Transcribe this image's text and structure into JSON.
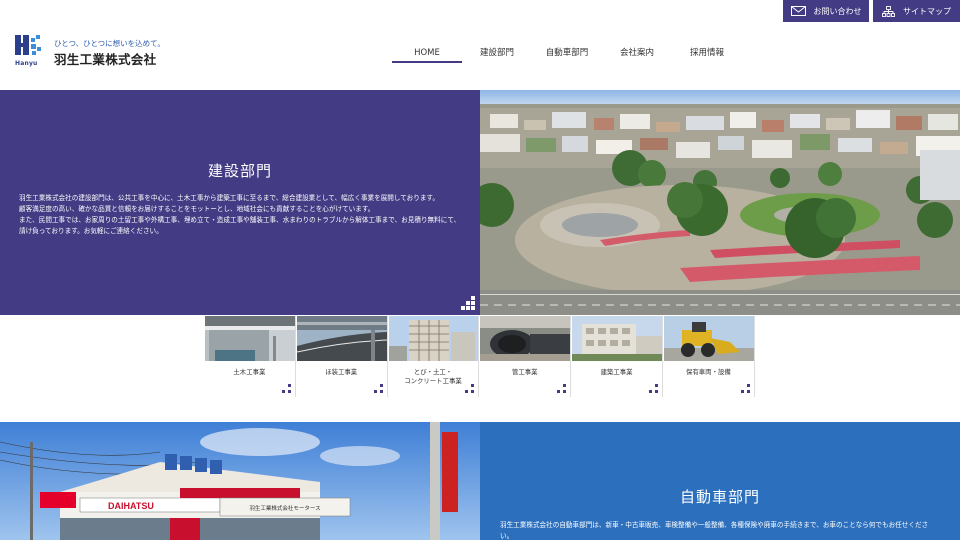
{
  "header": {
    "contact_label": "お問い合わせ",
    "sitemap_label": "サイトマップ",
    "logo": {
      "slogan": "ひとつ、ひとつに想いを込めて。",
      "company": "羽生工業株式会社",
      "mark_text": "Hanyu"
    }
  },
  "nav": {
    "items": [
      {
        "label": "HOME",
        "active": true
      },
      {
        "label": "建設部門",
        "active": false
      },
      {
        "label": "自動車部門",
        "active": false
      },
      {
        "label": "会社案内",
        "active": false
      },
      {
        "label": "採用情報",
        "active": false
      }
    ]
  },
  "construction": {
    "title": "建設部門",
    "desc": [
      "羽生工業株式会社の建設部門は、公共工事を中心に、土木工事から建築工事に至るまで、総合建設業として、幅広く事業を展開しております。",
      "顧客満足度の高い、確かな品質と信頼をお届けすることをモットーとし、地域社会にも貢献することを心がけています。",
      "また、民間工事では、お家周りの土留工事や外構工事、埋め立て・造成工事や舗装工事、水まわりのトラブルから解体工事まで、お見積り無料にて、請け負っております。お気軽にご連絡ください。"
    ]
  },
  "categories": [
    {
      "label": "土木工事業"
    },
    {
      "label": "ほ装工事業"
    },
    {
      "label": "とび・土工・\nコンクリート工事業"
    },
    {
      "label": "管工事業"
    },
    {
      "label": "建築工事業"
    },
    {
      "label": "保有車両・設備"
    }
  ],
  "automotive": {
    "title": "自動車部門",
    "desc": "羽生工業株式会社の自動車部門は、新車・中古車販売、車検整備や一般整備、各種保険や廃車の手続きまで、お車のことなら何でもお任せください。"
  },
  "photo_signs": {
    "dealer_brand": "DAIHATSU",
    "shop_banner": "羽生工業株式会社モータース"
  },
  "colors": {
    "brand_purple": "#433b83",
    "auto_blue": "#2c6fbd"
  }
}
